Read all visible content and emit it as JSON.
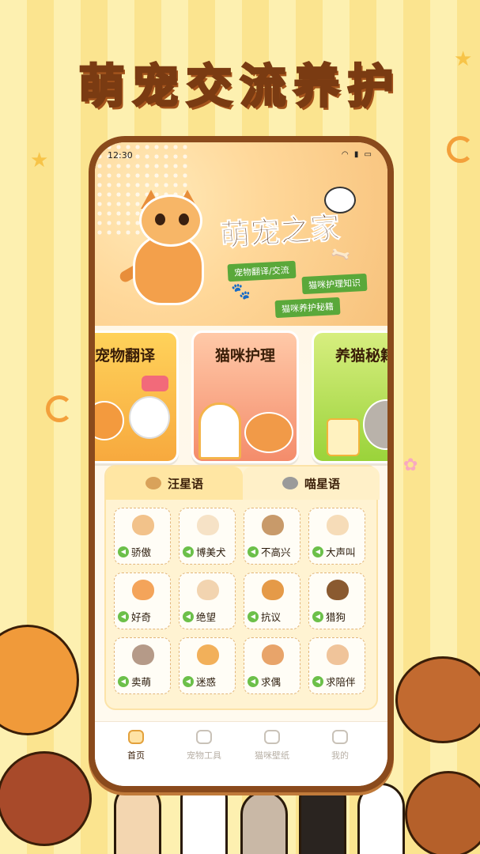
{
  "promo": {
    "title": "萌宠交流养护"
  },
  "status": {
    "time": "12:30",
    "icons": "wifi-icon signal-icon battery-icon"
  },
  "hero": {
    "title": "萌宠之家",
    "tags": [
      "宠物翻译/交流",
      "猫咪护理知识",
      "猫咪养护秘籍"
    ]
  },
  "cards": [
    {
      "title": "宠物翻译",
      "color": "#f7a93e"
    },
    {
      "title": "猫咪护理",
      "color": "#f48c6b"
    },
    {
      "title": "养猫秘籍",
      "color": "#9ad33a"
    }
  ],
  "tabs": {
    "active": "汪星语",
    "inactive": "喵星语"
  },
  "sounds": [
    {
      "label": "骄傲",
      "color": "#f2c28a"
    },
    {
      "label": "博美犬",
      "color": "#f6e2c6"
    },
    {
      "label": "不高兴",
      "color": "#c89a6a"
    },
    {
      "label": "大声叫",
      "color": "#f6dcb8"
    },
    {
      "label": "好奇",
      "color": "#f4a45a"
    },
    {
      "label": "绝望",
      "color": "#f2d4b0"
    },
    {
      "label": "抗议",
      "color": "#e59a48"
    },
    {
      "label": "猎狗",
      "color": "#8a5a30"
    },
    {
      "label": "卖萌",
      "color": "#b59a88"
    },
    {
      "label": "迷惑",
      "color": "#f2b05a"
    },
    {
      "label": "求偶",
      "color": "#e8a46a"
    },
    {
      "label": "求陪伴",
      "color": "#f0c49a"
    }
  ],
  "nav": [
    {
      "label": "首页",
      "icon": "home-icon",
      "active": true
    },
    {
      "label": "宠物工具",
      "icon": "tools-icon",
      "active": false
    },
    {
      "label": "猫咪壁纸",
      "icon": "cat-wallpaper-icon",
      "active": false
    },
    {
      "label": "我的",
      "icon": "profile-icon",
      "active": false
    }
  ],
  "colors": {
    "accent": "#e3a13c",
    "brand_brown": "#7a3b12",
    "sound_green": "#6cc04a"
  }
}
